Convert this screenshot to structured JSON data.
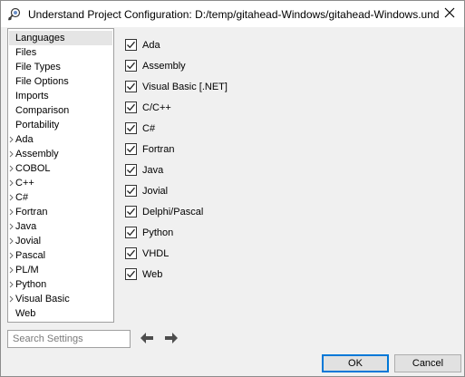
{
  "window": {
    "title": "Understand Project Configuration: D:/temp/gitahead-Windows/gitahead-Windows.und",
    "close_icon": "close-icon",
    "app_icon": "understand-app-icon"
  },
  "sidebar": {
    "items": [
      {
        "label": "Languages",
        "expandable": false,
        "selected": true
      },
      {
        "label": "Files",
        "expandable": false
      },
      {
        "label": "File Types",
        "expandable": false
      },
      {
        "label": "File Options",
        "expandable": false
      },
      {
        "label": "Imports",
        "expandable": false
      },
      {
        "label": "Comparison",
        "expandable": false
      },
      {
        "label": "Portability",
        "expandable": false
      },
      {
        "label": "Ada",
        "expandable": true
      },
      {
        "label": "Assembly",
        "expandable": true
      },
      {
        "label": "COBOL",
        "expandable": true
      },
      {
        "label": "C++",
        "expandable": true
      },
      {
        "label": "C#",
        "expandable": true
      },
      {
        "label": "Fortran",
        "expandable": true
      },
      {
        "label": "Java",
        "expandable": true
      },
      {
        "label": "Jovial",
        "expandable": true
      },
      {
        "label": "Pascal",
        "expandable": true
      },
      {
        "label": "PL/M",
        "expandable": true
      },
      {
        "label": "Python",
        "expandable": true
      },
      {
        "label": "Visual Basic",
        "expandable": true
      },
      {
        "label": "Web",
        "expandable": false
      }
    ]
  },
  "languages": [
    {
      "label": "Ada",
      "checked": true
    },
    {
      "label": "Assembly",
      "checked": true
    },
    {
      "label": "Visual Basic [.NET]",
      "checked": true
    },
    {
      "label": "C/C++",
      "checked": true
    },
    {
      "label": "C#",
      "checked": true
    },
    {
      "label": "Fortran",
      "checked": true
    },
    {
      "label": "Java",
      "checked": true
    },
    {
      "label": "Jovial",
      "checked": true
    },
    {
      "label": "Delphi/Pascal",
      "checked": true
    },
    {
      "label": "Python",
      "checked": true
    },
    {
      "label": "VHDL",
      "checked": true
    },
    {
      "label": "Web",
      "checked": true
    }
  ],
  "search": {
    "placeholder": "Search Settings",
    "value": ""
  },
  "nav_arrows": {
    "back_icon": "arrow-left-icon",
    "forward_icon": "arrow-right-icon"
  },
  "buttons": {
    "ok": "OK",
    "cancel": "Cancel"
  },
  "colors": {
    "selection": "#e5e5e5",
    "default_button_border": "#0078d7",
    "arrow": "#4d4d4d"
  }
}
